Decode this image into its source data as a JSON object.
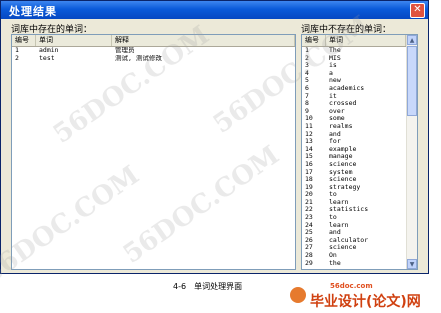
{
  "window": {
    "title": "处理结果",
    "close_glyph": "✕"
  },
  "left_panel": {
    "label": "词库中存在的单词：",
    "headers": [
      "编号",
      "单词",
      "解释"
    ],
    "rows": [
      {
        "id": "1",
        "word": "admin",
        "meaning": "管理员"
      },
      {
        "id": "2",
        "word": "test",
        "meaning": "测试, 测试修改"
      }
    ]
  },
  "right_panel": {
    "label": "词库中不存在的单词：",
    "headers": [
      "编号",
      "单词"
    ],
    "rows": [
      [
        "1",
        "The"
      ],
      [
        "2",
        "MIS"
      ],
      [
        "3",
        "is"
      ],
      [
        "4",
        "a"
      ],
      [
        "5",
        "new"
      ],
      [
        "6",
        "academics"
      ],
      [
        "7",
        "it"
      ],
      [
        "8",
        "crossed"
      ],
      [
        "9",
        "over"
      ],
      [
        "10",
        "some"
      ],
      [
        "11",
        "realms"
      ],
      [
        "12",
        "and"
      ],
      [
        "13",
        "for"
      ],
      [
        "14",
        "example"
      ],
      [
        "15",
        "manage"
      ],
      [
        "16",
        "science"
      ],
      [
        "17",
        "system"
      ],
      [
        "18",
        "science"
      ],
      [
        "19",
        "strategy"
      ],
      [
        "20",
        "to"
      ],
      [
        "21",
        "learn"
      ],
      [
        "22",
        "statistics"
      ],
      [
        "23",
        "to"
      ],
      [
        "24",
        "learn"
      ],
      [
        "25",
        "and"
      ],
      [
        "26",
        "calculator"
      ],
      [
        "27",
        "science"
      ],
      [
        "28",
        "On"
      ],
      [
        "29",
        "the"
      ]
    ]
  },
  "caption": "4-6　单词处理界面",
  "watermark": {
    "text": "56DOC.COM",
    "url": "56doc.com",
    "site_name": "毕业设计(论文)网"
  },
  "colors": {
    "titlebar": "#0a5ad9",
    "dialog_bg": "#ece9d8",
    "list_border": "#7f9db9"
  }
}
